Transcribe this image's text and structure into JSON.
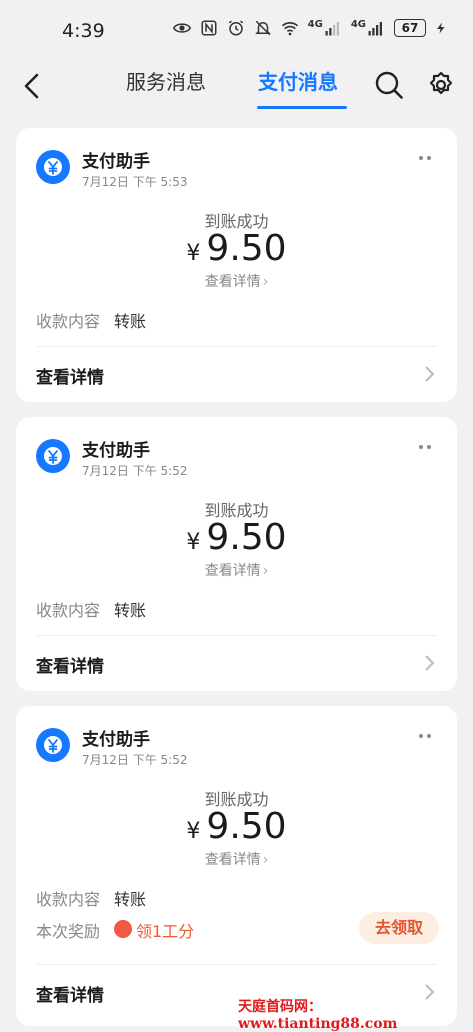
{
  "statusbar": {
    "time": "4:39",
    "battery": "67",
    "network_1": "4G",
    "network_2": "4G",
    "icons": [
      "eye-icon",
      "nfc-icon",
      "alarm-icon",
      "mute-icon",
      "wifi-icon",
      "signal-icon",
      "signal-icon",
      "battery-icon",
      "charging-icon"
    ]
  },
  "nav": {
    "tab_service": "服务消息",
    "tab_pay": "支付消息",
    "active_tab": "支付消息",
    "accent": "#1677ff"
  },
  "messages": [
    {
      "sender": "支付助手",
      "datetime": "7月12日 下午 5:53",
      "status": "到账成功",
      "currency": "¥",
      "amount": "9.50",
      "view_link": "查看详情",
      "field_label": "收款内容",
      "field_value": "转账",
      "footer": "查看详情"
    },
    {
      "sender": "支付助手",
      "datetime": "7月12日 下午 5:52",
      "status": "到账成功",
      "currency": "¥",
      "amount": "9.50",
      "view_link": "查看详情",
      "field_label": "收款内容",
      "field_value": "转账",
      "footer": "查看详情"
    },
    {
      "sender": "支付助手",
      "datetime": "7月12日 下午 5:52",
      "status": "到账成功",
      "currency": "¥",
      "amount": "9.50",
      "view_link": "查看详情",
      "field_label": "收款内容",
      "field_value": "转账",
      "reward_label": "本次奖励",
      "reward_text": "领1工分",
      "claim_button": "去领取",
      "footer": "查看详情"
    }
  ],
  "watermark": "天庭首码网：www.tianting88.com"
}
